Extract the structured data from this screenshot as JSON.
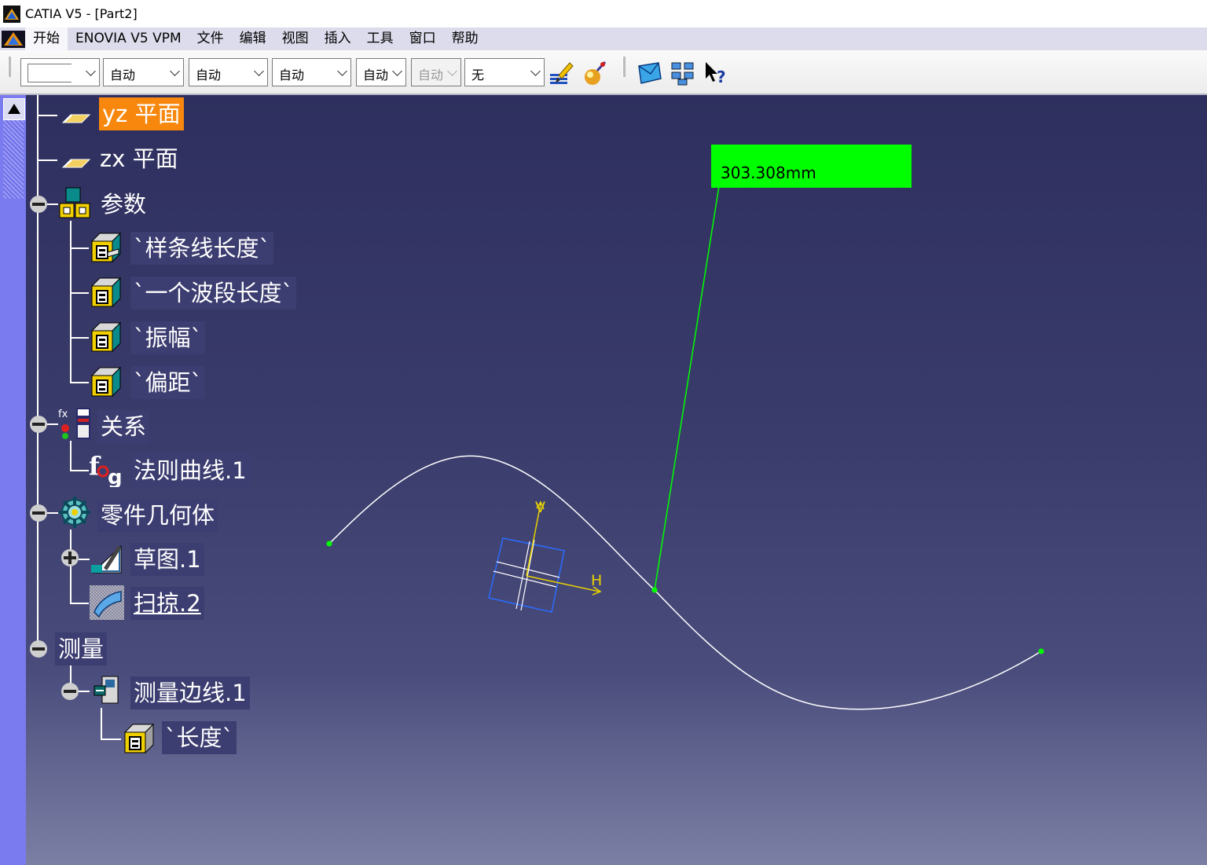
{
  "window": {
    "title": "CATIA V5 - [Part2]",
    "icon": "catia-icon"
  },
  "menu": {
    "items": [
      "开始",
      "ENOVIA V5 VPM",
      "文件",
      "编辑",
      "视图",
      "插入",
      "工具",
      "窗口",
      "帮助"
    ],
    "active_index": 0
  },
  "toolbar": {
    "combos": [
      {
        "value": "",
        "kind": "line-color"
      },
      {
        "value": "自动"
      },
      {
        "value": "自动"
      },
      {
        "value": "自动"
      },
      {
        "value": "自动"
      },
      {
        "value": "自动",
        "disabled": true
      },
      {
        "value": "无"
      }
    ],
    "icons": [
      "painter-brush-icon",
      "apply-material-icon",
      "open-catalog-icon",
      "view-mode-icon",
      "whats-this-help-icon"
    ]
  },
  "tree": {
    "nodes": [
      {
        "label": "yz 平面",
        "icon": "plane-icon",
        "selected": true
      },
      {
        "label": "zx 平面",
        "icon": "plane-icon"
      },
      {
        "label": "参数",
        "icon": "parameters-icon"
      },
      {
        "label": "`样条线长度`",
        "icon": "parameter-icon"
      },
      {
        "label": "`一个波段长度`",
        "icon": "parameter-icon"
      },
      {
        "label": "`振幅`",
        "icon": "parameter-icon"
      },
      {
        "label": "`偏距`",
        "icon": "parameter-icon"
      },
      {
        "label": "关系",
        "icon": "relations-icon"
      },
      {
        "label": "法则曲线.1",
        "icon": "law-fog-icon"
      },
      {
        "label": "零件几何体",
        "icon": "part-body-icon"
      },
      {
        "label": "草图.1",
        "icon": "sketch-icon"
      },
      {
        "label": "扫掠.2",
        "icon": "sweep-icon",
        "underline": true
      },
      {
        "label": "测量",
        "icon": ""
      },
      {
        "label": "测量边线.1",
        "icon": "measure-edge-icon"
      },
      {
        "label": "`长度`",
        "icon": "parameter-icon"
      }
    ]
  },
  "viewport": {
    "measurement_value": "303.308mm",
    "sketch_axis_v": "V",
    "sketch_axis_h": "H",
    "colors": {
      "curve": "#ffffff",
      "measure": "#00ff00",
      "axis": "#e8d200",
      "plane": "#2a6cff"
    }
  }
}
